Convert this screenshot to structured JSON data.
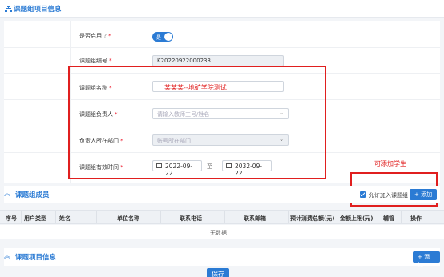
{
  "colors": {
    "accent": "#2b7bd4",
    "annotation": "#e01f1f"
  },
  "info_section": {
    "title": "课题组项目信息",
    "icon": "org-chart-icon"
  },
  "form": {
    "enabled": {
      "label": "是否启用",
      "toggle_text": "是",
      "toggle_on": true,
      "help_icon": "question-circle-icon"
    },
    "group_no": {
      "label": "课题组编号",
      "value": "K20220922000233"
    },
    "group_name": {
      "label": "课题组名称",
      "value": "某某某--地矿学院测试"
    },
    "leader": {
      "label": "课题组负责人",
      "placeholder": "请输入教师工号/姓名"
    },
    "department": {
      "label": "负责人所在部门",
      "placeholder": "账号所在部门"
    },
    "valid_time": {
      "label": "课题组有效时间",
      "start": "2022-09-22",
      "sep": "至",
      "end": "2032-09-22"
    }
  },
  "annotation": {
    "text": "可添加学生"
  },
  "members": {
    "title": "课题组成员",
    "allow_join_label": "允许加入课题组",
    "add_label": "+ 添加",
    "columns": [
      "序号",
      "用户类型",
      "姓名",
      "单位名称",
      "联系电话",
      "联系邮箱",
      "预计消费总额(元)",
      "金额上限(元)",
      "辅管",
      "操作"
    ],
    "empty_text": "无数据"
  },
  "projects": {
    "title": "课题项目信息",
    "add_label": "+ 添加"
  },
  "save_label": "保存"
}
